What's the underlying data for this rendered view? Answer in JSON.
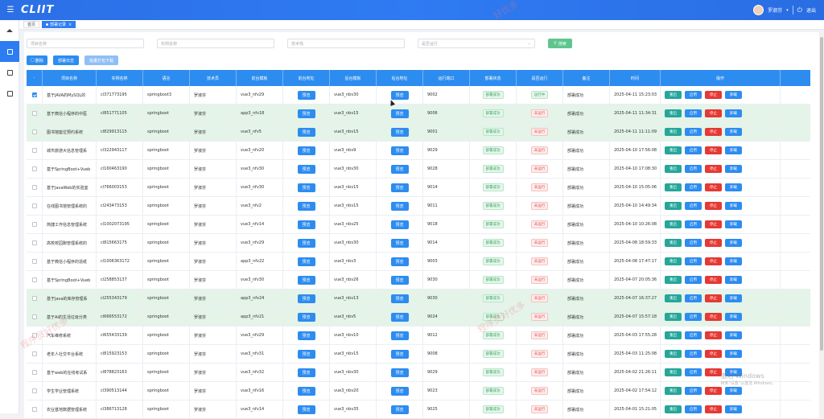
{
  "app": {
    "logo": "CLIIT",
    "user_name": "罗淑芬",
    "logout": "退出"
  },
  "tabs": [
    {
      "label": "首页",
      "active": false
    },
    {
      "label": "部署记录",
      "active": true
    }
  ],
  "filters": {
    "project_name_placeholder": "项目名称",
    "instance_name_placeholder": "实例名称",
    "tech_placeholder": "技术栈",
    "status_placeholder": "是否运行",
    "search_label": "搜索"
  },
  "actions": {
    "delete_label": "删除",
    "deploy_log_label": "部署日志",
    "batch_download_label": "批量打包下载"
  },
  "colors": {
    "primary": "#2d8cf0",
    "success": "#5fc58e",
    "danger": "#e53935",
    "teal": "#26a69a"
  },
  "table": {
    "headers": [
      "项目名称",
      "实例名称",
      "语言",
      "技术员",
      "前台模板",
      "前台地址",
      "后台模板",
      "后台地址",
      "运行端口",
      "部署状态",
      "是否运行",
      "备注",
      "时间",
      "操作"
    ],
    "preview_label": "预览",
    "op_labels": [
      "重启",
      "启用",
      "停止",
      "卸载"
    ],
    "rows": [
      {
        "name": "基于JAVA的MySQL的",
        "instance": "cl371773195",
        "lang": "springboot3",
        "tech": "罗淑芬",
        "front": "vue3_nfv29",
        "back": "vue3_nbv30",
        "port": "9002",
        "deploy": "部署成功",
        "running": "运行中",
        "remark": "部署成功",
        "time": "2025-04-11 15:23:03",
        "hl": false,
        "checked": true
      },
      {
        "name": "基于微信小程序的中医",
        "instance": "cl851771105",
        "lang": "springboot",
        "tech": "罗淑芬",
        "front": "app3_nfv18",
        "back": "vue3_nbv15",
        "port": "9006",
        "deploy": "部署成功",
        "running": "未运行",
        "remark": "部署成功",
        "time": "2025-04-11 11:34:31",
        "hl": true,
        "checked": false
      },
      {
        "name": "图书馆座位预约系统",
        "instance": "cl829913115",
        "lang": "springboot",
        "tech": "罗淑芬",
        "front": "vue3_nfv5",
        "back": "vue3_nbv15",
        "port": "9001",
        "deploy": "部署成功",
        "running": "未运行",
        "remark": "部署成功",
        "time": "2025-04-11 11:11:09",
        "hl": true,
        "checked": false
      },
      {
        "name": "城市旅游大信息管理系",
        "instance": "cl322943117",
        "lang": "springboot",
        "tech": "罗淑芬",
        "front": "vue3_nfv20",
        "back": "vue3_nbv9",
        "port": "9029",
        "deploy": "部署成功",
        "running": "未运行",
        "remark": "部署成功",
        "time": "2025-04-10 17:56:08",
        "hl": false,
        "checked": false
      },
      {
        "name": "基于SpringBoot+Vueb",
        "instance": "cl160463190",
        "lang": "springboot",
        "tech": "罗淑芬",
        "front": "vue3_nfv30",
        "back": "vue3_nbv30",
        "port": "9028",
        "deploy": "部署成功",
        "running": "未运行",
        "remark": "部署成功",
        "time": "2025-04-10 17:08:30",
        "hl": false,
        "checked": false
      },
      {
        "name": "基于JavaWeb的实验室",
        "instance": "cl766003153",
        "lang": "springboot",
        "tech": "罗淑芬",
        "front": "vue3_nfv30",
        "back": "vue3_nbv15",
        "port": "9014",
        "deploy": "部署成功",
        "running": "未运行",
        "remark": "部署成功",
        "time": "2025-04-10 15:05:06",
        "hl": false,
        "checked": false
      },
      {
        "name": "在线图书馆管理系统的",
        "instance": "cl243473153",
        "lang": "springboot",
        "tech": "罗淑芬",
        "front": "vue3_nfv2",
        "back": "vue3_nbv15",
        "port": "9011",
        "deploy": "部署成功",
        "running": "未运行",
        "remark": "部署成功",
        "time": "2025-04-10 14:49:34",
        "hl": false,
        "checked": false
      },
      {
        "name": "简捷工作信息管理系统",
        "instance": "cl1002073195",
        "lang": "springboot",
        "tech": "罗淑芬",
        "front": "vue3_nfv14",
        "back": "vue3_nbv25",
        "port": "9018",
        "deploy": "部署成功",
        "running": "未运行",
        "remark": "部署成功",
        "time": "2025-04-10 10:26:08",
        "hl": false,
        "checked": false
      },
      {
        "name": "高校校园跑管理系统的",
        "instance": "cl815663175",
        "lang": "springboot",
        "tech": "罗淑芬",
        "front": "vue3_nfv29",
        "back": "vue3_nbv30",
        "port": "9014",
        "deploy": "部署成功",
        "running": "未运行",
        "remark": "部署成功",
        "time": "2025-04-08 18:59:33",
        "hl": false,
        "checked": false
      },
      {
        "name": "基于微信小程序的造纸",
        "instance": "cl1006363172",
        "lang": "springboot",
        "tech": "罗淑芬",
        "front": "app3_nfv22",
        "back": "vue3_nbv3",
        "port": "9003",
        "deploy": "部署成功",
        "running": "未运行",
        "remark": "部署成功",
        "time": "2025-04-08 17:47:17",
        "hl": false,
        "checked": false
      },
      {
        "name": "基于SpringBoot+Vueb",
        "instance": "cl258853137",
        "lang": "springboot",
        "tech": "罗淑芬",
        "front": "vue3_nfv30",
        "back": "vue3_nbv26",
        "port": "9030",
        "deploy": "部署成功",
        "running": "未运行",
        "remark": "部署成功",
        "time": "2025-04-07 20:05:36",
        "hl": false,
        "checked": false
      },
      {
        "name": "基于Java的库存管理系",
        "instance": "cl255343179",
        "lang": "springboot",
        "tech": "罗淑芬",
        "front": "app3_nfv24",
        "back": "vue3_nbv13",
        "port": "9030",
        "deploy": "部署成功",
        "running": "未运行",
        "remark": "部署成功",
        "time": "2025-04-07 16:37:27",
        "hl": true,
        "checked": false
      },
      {
        "name": "基于AI的生活垃圾分类",
        "instance": "cl666553172",
        "lang": "springboot",
        "tech": "罗淑芬",
        "front": "app3_nfv21",
        "back": "vue3_nbv5",
        "port": "9024",
        "deploy": "部署成功",
        "running": "未运行",
        "remark": "部署成功",
        "time": "2025-04-07 15:57:18",
        "hl": true,
        "checked": false
      },
      {
        "name": "汽车维修系统",
        "instance": "cl655433139",
        "lang": "springboot",
        "tech": "罗淑芬",
        "front": "vue3_nfv29",
        "back": "vue3_nbv10",
        "port": "9012",
        "deploy": "部署成功",
        "running": "未运行",
        "remark": "部署成功",
        "time": "2025-04-03 17:55:28",
        "hl": false,
        "checked": false
      },
      {
        "name": "老年人社交平台系统",
        "instance": "cl815923153",
        "lang": "springboot",
        "tech": "罗淑芬",
        "front": "vue3_nfv31",
        "back": "vue3_nbv15",
        "port": "9008",
        "deploy": "部署成功",
        "running": "未运行",
        "remark": "部署成功",
        "time": "2025-04-03 11:25:08",
        "hl": false,
        "checked": false
      },
      {
        "name": "基于web的在线考试系",
        "instance": "cl878823163",
        "lang": "springboot",
        "tech": "罗淑芬",
        "front": "vue3_nfv32",
        "back": "vue3_nbv30",
        "port": "9029",
        "deploy": "部署成功",
        "running": "未运行",
        "remark": "部署成功",
        "time": "2025-04-02 21:26:11",
        "hl": false,
        "checked": false
      },
      {
        "name": "学生学业管理系统",
        "instance": "cl390513144",
        "lang": "springboot",
        "tech": "罗淑芬",
        "front": "vue3_nfv16",
        "back": "vue3_nbv20",
        "port": "9023",
        "deploy": "部署成功",
        "running": "未运行",
        "remark": "部署成功",
        "time": "2025-04-02 17:54:12",
        "hl": false,
        "checked": false
      },
      {
        "name": "农业基地数据管理系统",
        "instance": "cl386713128",
        "lang": "springboot",
        "tech": "罗淑芬",
        "front": "vue3_nfv14",
        "back": "vue3_nbv35",
        "port": "9025",
        "deploy": "部署成功",
        "running": "未运行",
        "remark": "部署成功",
        "time": "2025-04-01 15:21:05",
        "hl": false,
        "checked": false
      }
    ]
  },
  "watermarks": [
    "程序员好优多",
    "程序员好优多",
    "好优多"
  ],
  "os_notice": {
    "title": "激活 Windows",
    "subtitle": "转到\"设置\"以激活 Windows。"
  }
}
